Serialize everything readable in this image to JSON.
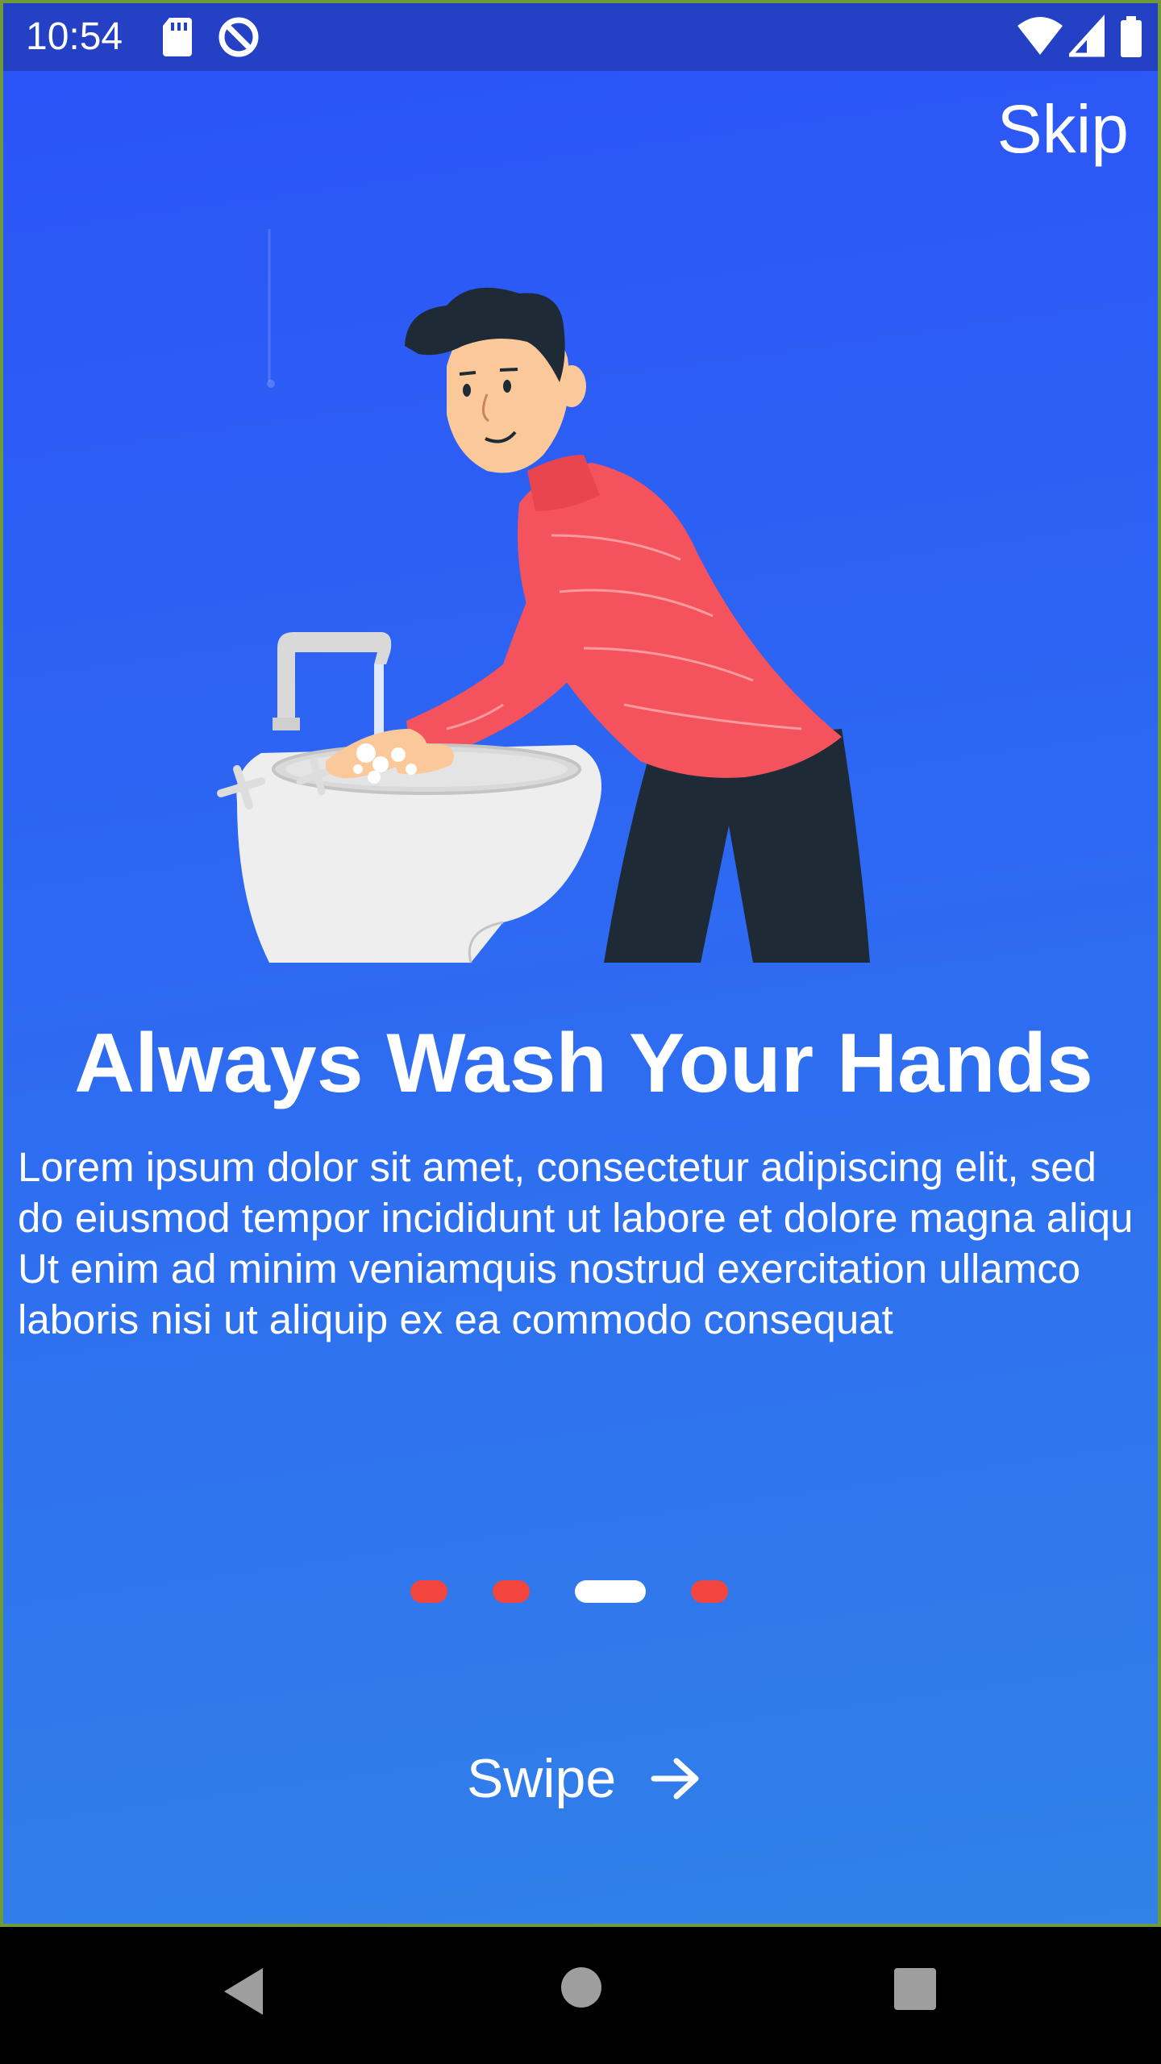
{
  "status_bar": {
    "time": "10:54",
    "icons": [
      "sd-card-icon",
      "data-saver-icon",
      "wifi-icon",
      "signal-icon",
      "battery-icon"
    ]
  },
  "header": {
    "skip_label": "Skip"
  },
  "onboarding": {
    "illustration": "man-washing-hands-illustration",
    "title": "Always Wash Your Hands",
    "body": "Lorem ipsum dolor sit amet, consectetur adipiscing elit, sed do eiusmod tempor incididunt ut labore et dolore magna aliqu Ut enim ad minim veniamquis nostrud exercitation ullamco laboris nisi ut aliquip ex ea commodo consequat",
    "page_indicator": {
      "total": 4,
      "active_index": 2,
      "active_color": "#ffffff",
      "inactive_color": "#f2453d"
    }
  },
  "footer": {
    "swipe_label": "Swipe",
    "swipe_icon": "arrow-right-icon"
  },
  "nav_bar": {
    "buttons": [
      "back-icon",
      "home-icon",
      "recents-icon"
    ]
  },
  "colors": {
    "background_top": "#2b52f8",
    "background_bottom": "#3181e8",
    "status_bar": "#2440c4",
    "sweater": "#f4525c",
    "pants": "#1e2a35"
  }
}
